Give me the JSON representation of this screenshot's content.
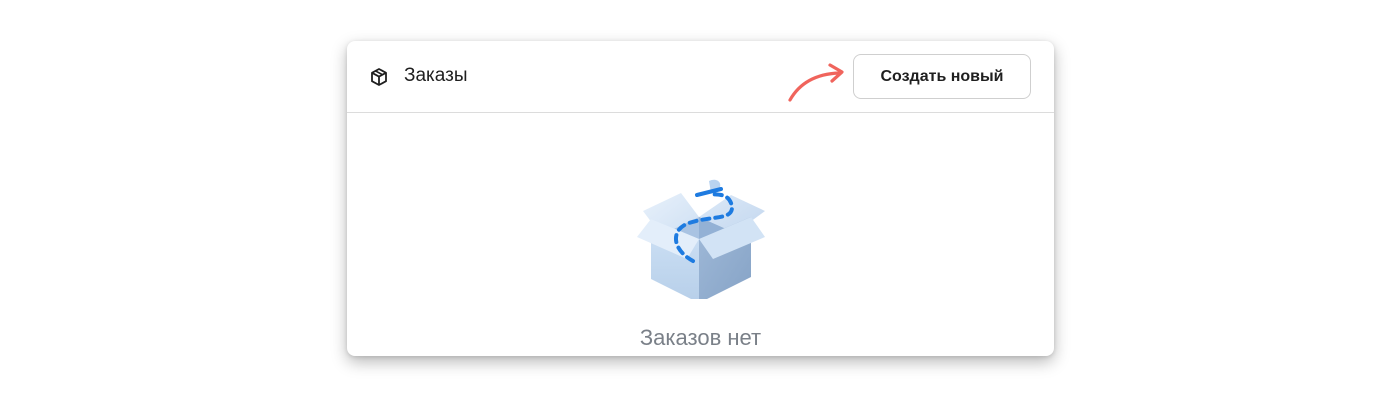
{
  "header": {
    "title": "Заказы",
    "icon": "package-icon"
  },
  "toolbar": {
    "create_label": "Создать новый"
  },
  "annotation": {
    "arrow_color": "#f0645c"
  },
  "empty_state": {
    "message": "Заказов нет",
    "icon": "empty-box-icon",
    "accent": "#1e7be0"
  }
}
